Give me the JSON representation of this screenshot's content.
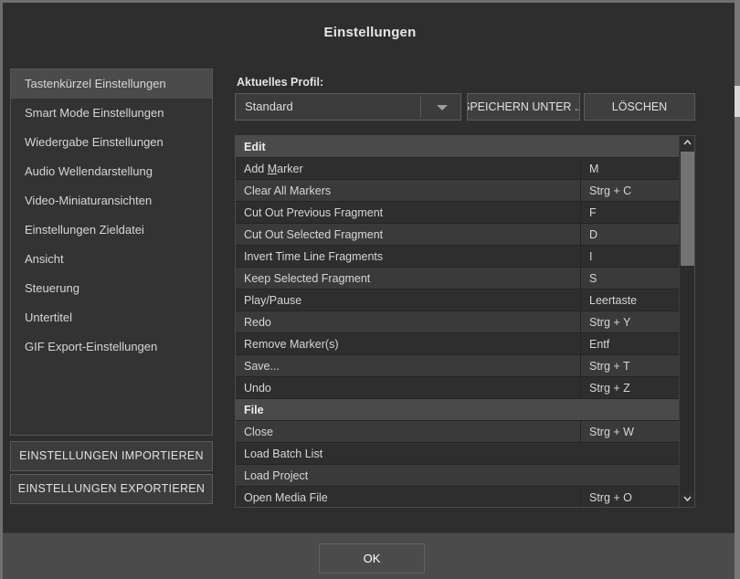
{
  "window": {
    "title": "Einstellungen"
  },
  "sidebar": {
    "items": [
      {
        "label": "Tastenkürzel Einstellungen",
        "selected": true
      },
      {
        "label": "Smart Mode Einstellungen",
        "selected": false
      },
      {
        "label": "Wiedergabe Einstellungen",
        "selected": false
      },
      {
        "label": "Audio Wellendarstellung",
        "selected": false
      },
      {
        "label": "Video-Miniaturansichten",
        "selected": false
      },
      {
        "label": "Einstellungen Zieldatei",
        "selected": false
      },
      {
        "label": "Ansicht",
        "selected": false
      },
      {
        "label": "Steuerung",
        "selected": false
      },
      {
        "label": "Untertitel",
        "selected": false
      },
      {
        "label": "GIF Export-Einstellungen",
        "selected": false
      }
    ],
    "import_button": "EINSTELLUNGEN IMPORTIEREN",
    "export_button": "EINSTELLUNGEN EXPORTIEREN"
  },
  "profile": {
    "label": "Aktuelles Profil:",
    "selected": "Standard",
    "options": [
      "Standard"
    ],
    "save_as_button": "SPEICHERN UNTER ...",
    "delete_button": "LÖSCHEN"
  },
  "shortcuts_table": {
    "rows": [
      {
        "type": "group",
        "action": "Edit",
        "key": ""
      },
      {
        "type": "item",
        "action": "Add Marker",
        "key": "M",
        "mnemonic": "M"
      },
      {
        "type": "item",
        "action": "Clear All Markers",
        "key": "Strg + C"
      },
      {
        "type": "item",
        "action": "Cut Out Previous Fragment",
        "key": "F"
      },
      {
        "type": "item",
        "action": "Cut Out Selected Fragment",
        "key": "D"
      },
      {
        "type": "item",
        "action": "Invert Time Line Fragments",
        "key": "I"
      },
      {
        "type": "item",
        "action": "Keep Selected Fragment",
        "key": "S"
      },
      {
        "type": "item",
        "action": "Play/Pause",
        "key": "Leertaste"
      },
      {
        "type": "item",
        "action": "Redo",
        "key": "Strg + Y"
      },
      {
        "type": "item",
        "action": "Remove Marker(s)",
        "key": "Entf"
      },
      {
        "type": "item",
        "action": "Save...",
        "key": "Strg + T"
      },
      {
        "type": "item",
        "action": "Undo",
        "key": "Strg + Z"
      },
      {
        "type": "group",
        "action": "File",
        "key": ""
      },
      {
        "type": "item",
        "action": "Close",
        "key": "Strg + W"
      },
      {
        "type": "item",
        "action": "Load Batch List",
        "key": ""
      },
      {
        "type": "item",
        "action": "Load Project",
        "key": ""
      },
      {
        "type": "item",
        "action": "Open Media File",
        "key": "Strg + O"
      }
    ]
  },
  "footer": {
    "ok_button": "OK"
  },
  "colors": {
    "dialog_bg": "#2e2e2e",
    "panel_bg": "#333333",
    "row_odd": "#2e2e2e",
    "row_even": "#3a3a3a",
    "group_header_bg": "#4a4a4a",
    "selection_bg": "#4b4b4b",
    "text": "#d6d6d6",
    "footer_bg": "#4b4b4b",
    "scrollbar_thumb": "#737373"
  }
}
